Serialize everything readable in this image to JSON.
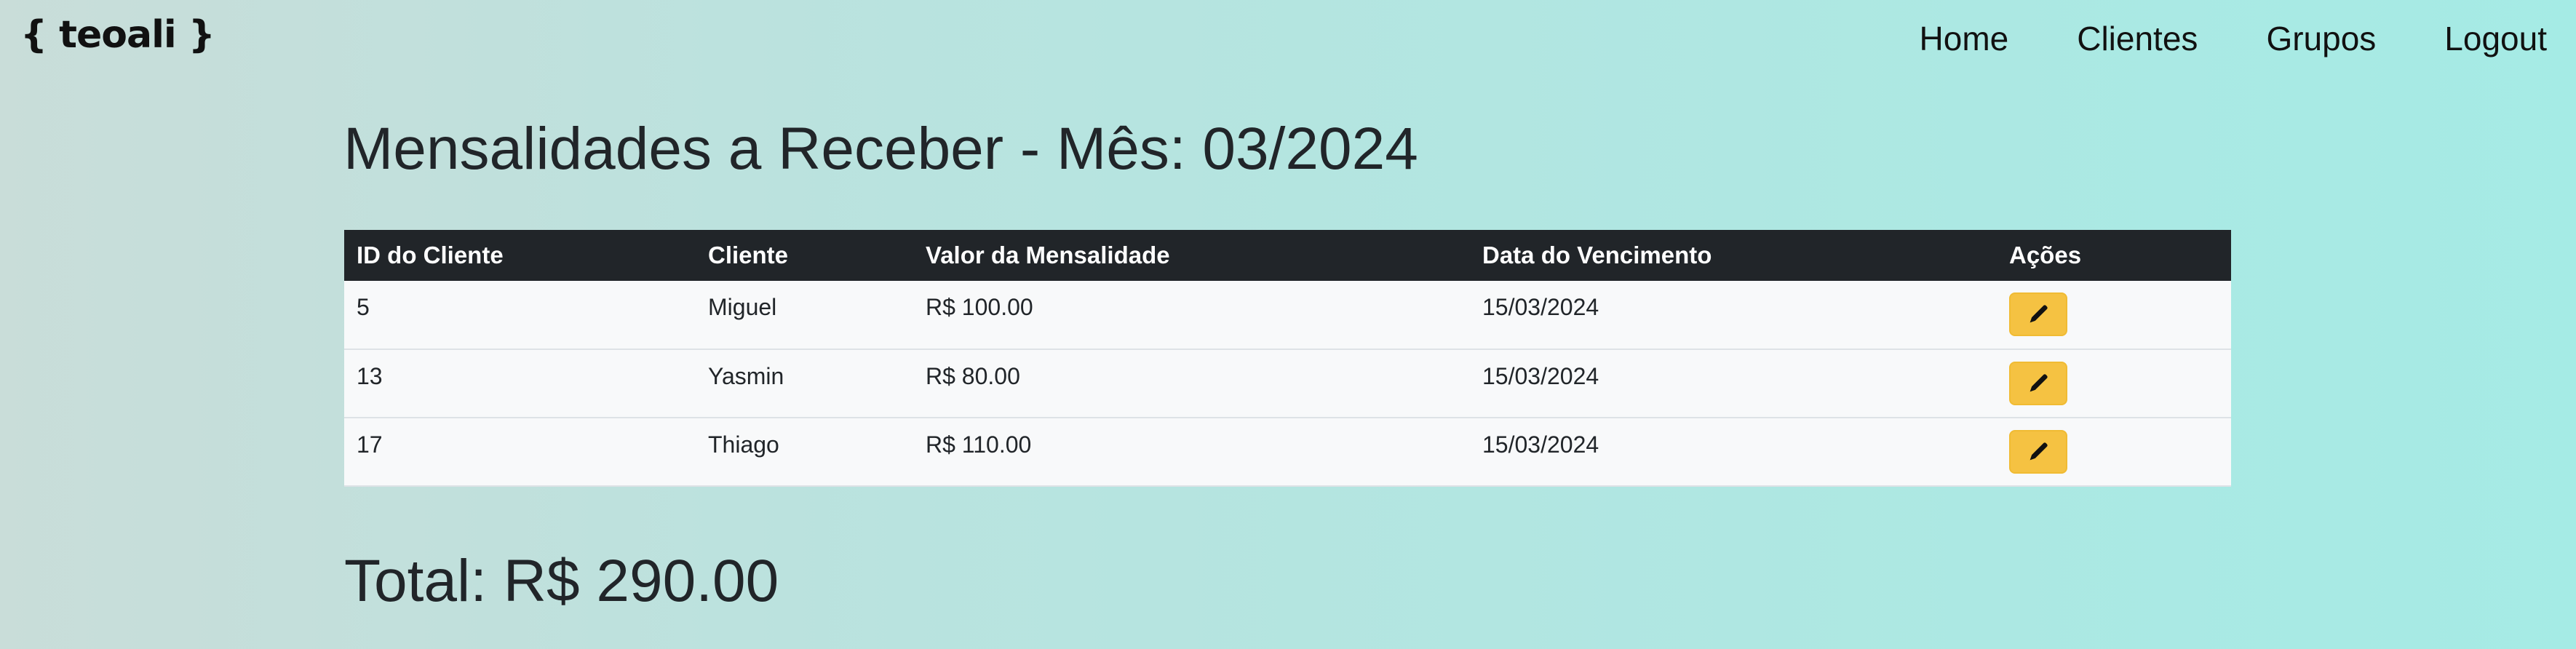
{
  "brand": {
    "logo": "{ teoali }"
  },
  "nav": {
    "items": [
      {
        "label": "Home"
      },
      {
        "label": "Clientes"
      },
      {
        "label": "Grupos"
      },
      {
        "label": "Logout"
      }
    ]
  },
  "main": {
    "title": "Mensalidades a Receber - Mês: 03/2024",
    "table": {
      "headers": [
        "ID do Cliente",
        "Cliente",
        "Valor da Mensalidade",
        "Data do Vencimento",
        "Ações"
      ],
      "rows": [
        {
          "id": "5",
          "cliente": "Miguel",
          "valor": "R$ 100.00",
          "vencimento": "15/03/2024",
          "action_icon": "pencil-icon"
        },
        {
          "id": "13",
          "cliente": "Yasmin",
          "valor": "R$ 80.00",
          "vencimento": "15/03/2024",
          "action_icon": "pencil-icon"
        },
        {
          "id": "17",
          "cliente": "Thiago",
          "valor": "R$ 110.00",
          "vencimento": "15/03/2024",
          "action_icon": "pencil-icon"
        }
      ]
    },
    "total": "Total: R$ 290.00"
  },
  "colors": {
    "header_bg": "#212529",
    "edit_button": "#f5c242",
    "row_bg": "#f8f9fa"
  }
}
